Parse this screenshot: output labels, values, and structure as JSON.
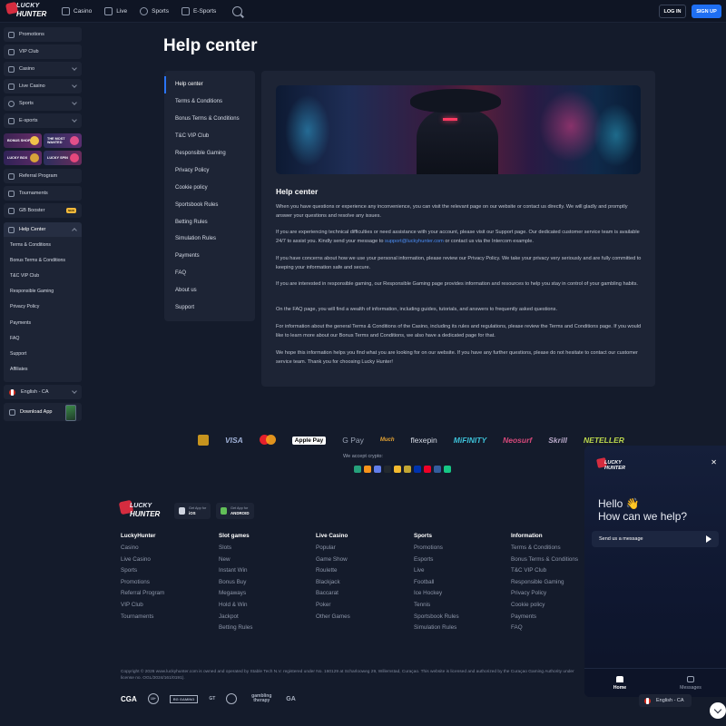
{
  "header": {
    "logo_line1": "LUCKY",
    "logo_line2": "HUNTER",
    "nav": [
      "Casino",
      "Live",
      "Sports",
      "E-Sports"
    ],
    "login": "LOG IN",
    "signup": "SIGN UP",
    "accent": "#1f6ff2"
  },
  "sidebar": {
    "items": [
      "Promotions",
      "VIP Club",
      "Casino",
      "Live Casino",
      "Sports",
      "E-sports"
    ],
    "promos": [
      "BONUS SHOP",
      "THE MOST WANTED",
      "LUCKY BOX",
      "LUCKY SPIN"
    ],
    "extra": [
      "Referral Program",
      "Tournaments",
      "GB Booster"
    ],
    "gb_tag": "NEW",
    "help_head": "Help Center",
    "help_items": [
      "Terms & Conditions",
      "Bonus Terms & Conditions",
      "T&C VIP Club",
      "Responsible Gaming",
      "Privacy Policy",
      "Payments",
      "FAQ",
      "Support",
      "Affiliates"
    ],
    "language": "English - CA",
    "download": "Download App"
  },
  "page": {
    "title": "Help center",
    "menu": [
      "Help center",
      "Terms & Conditions",
      "Bonus Terms & Conditions",
      "T&C VIP Club",
      "Responsible Gaming",
      "Privacy Policy",
      "Cookie policy",
      "Sportsbook Rules",
      "Betting Rules",
      "Simulation Rules",
      "Payments",
      "FAQ",
      "About us",
      "Support"
    ],
    "heading": "Help center",
    "p1": "When you have questions or experience any inconvenience, you can visit the relevant page on our website or contact us directly. We will gladly and promptly answer your questions and resolve any issues.",
    "p2_before": "If you are experiencing technical difficulties or need assistance with your account, please visit our Support page. Our dedicated customer service team is available 24/7 to assist you. Kindly send your message to ",
    "p2_link": "support@luckyhunter.com",
    "p2_after": " or contact us via the Intercom example.",
    "p3": "If you have concerns about how we use your personal information, please review our Privacy Policy. We take your privacy very seriously and are fully committed to keeping your information safe and secure.",
    "p4": "If you are interested in responsible gaming, our Responsible Gaming page provides information and resources to help you stay in control of your gambling habits.",
    "p5": "On the FAQ page, you will find a wealth of information, including guides, tutorials, and answers to frequently asked questions.",
    "p6": "For information about the general Terms & Conditions of the Casino, including its rules and regulations, please review the Terms and Conditions page. If you would like to learn more about our Bonus Terms and Conditions, we also have a dedicated page for that.",
    "p7": "We hope this information helps you find what you are looking for on our website. If you have any further questions, please do not hesitate to contact our customer service team. Thank you for choosing Lucky Hunter!"
  },
  "payments": [
    "VISA",
    "Apple Pay",
    "G Pay",
    "Much",
    "flexepin",
    "MiFINITY",
    "Neosurf",
    "Skrill",
    "NETELLER"
  ],
  "crypto_label": "We accept crypto:",
  "footer": {
    "app_ios_small": "Get App for",
    "app_ios": "iOS",
    "app_android_small": "Get App for",
    "app_android": "ANDROID",
    "columns": [
      {
        "title": "LuckyHunter",
        "links": [
          "Casino",
          "Live Casino",
          "Sports",
          "Promotions",
          "Referral Program",
          "VIP Club",
          "Tournaments"
        ]
      },
      {
        "title": "Slot games",
        "links": [
          "Slots",
          "New",
          "Instant Win",
          "Bonus Buy",
          "Megaways",
          "Hold & Win",
          "Jackpot",
          "Betting Rules"
        ]
      },
      {
        "title": "Live Casino",
        "links": [
          "Popular",
          "Game Show",
          "Roulette",
          "Blackjack",
          "Baccarat",
          "Poker",
          "Other Games"
        ]
      },
      {
        "title": "Sports",
        "links": [
          "Promotions",
          "Esports",
          "Live",
          "Football",
          "Ice Hockey",
          "Tennis",
          "Sportsbook Rules",
          "Simulation Rules"
        ]
      },
      {
        "title": "Information",
        "links": [
          "Terms & Conditions",
          "Bonus Terms & Conditions",
          "T&C VIP Club",
          "Responsible Gaming",
          "Privacy Policy",
          "Cookie policy",
          "Payments",
          "FAQ"
        ]
      }
    ],
    "copyright": "Copyright © 2026 www.luckyhunter.com is owned and operated by Stable Tech N.V. registered under No. 160129 at Scharlooweg 29, Willemstad, Curaçao. This website is licensed and authorized by the Curaçao Gaming Authority under license no. OGL/2024/161/0191).",
    "licenses": [
      "CGA",
      "18+",
      "RG GAMING",
      "GT",
      "gambling therapy",
      "GA"
    ]
  },
  "chat": {
    "hello": "Hello 👋",
    "question": "How can we help?",
    "send": "Send us a message",
    "tabs": [
      "Home",
      "Messages"
    ],
    "close": "✕"
  },
  "lang_bottom": "English - CA"
}
